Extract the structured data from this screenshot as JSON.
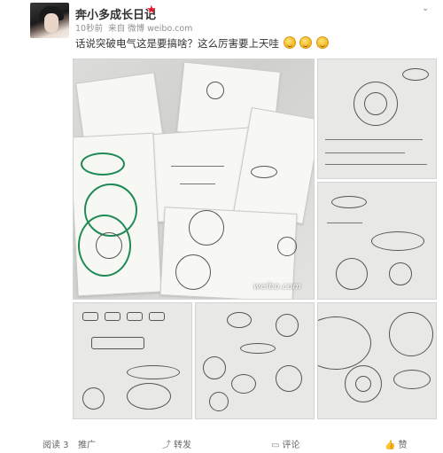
{
  "post": {
    "username": "奔小多成长日记",
    "time": "10秒前",
    "source": "来自 微博 weibo.com",
    "text": "话说突破电气这是要搞啥？这么厉害要上天哇",
    "watermark": "weibo.com"
  },
  "actions": {
    "read_label": "阅读 3",
    "promote_label": "推广",
    "repost_label": "转发",
    "comment_label": "评论",
    "like_label": "赞"
  },
  "colors": {
    "vip": "#e6162d",
    "marker_green": "#1f8a55"
  }
}
